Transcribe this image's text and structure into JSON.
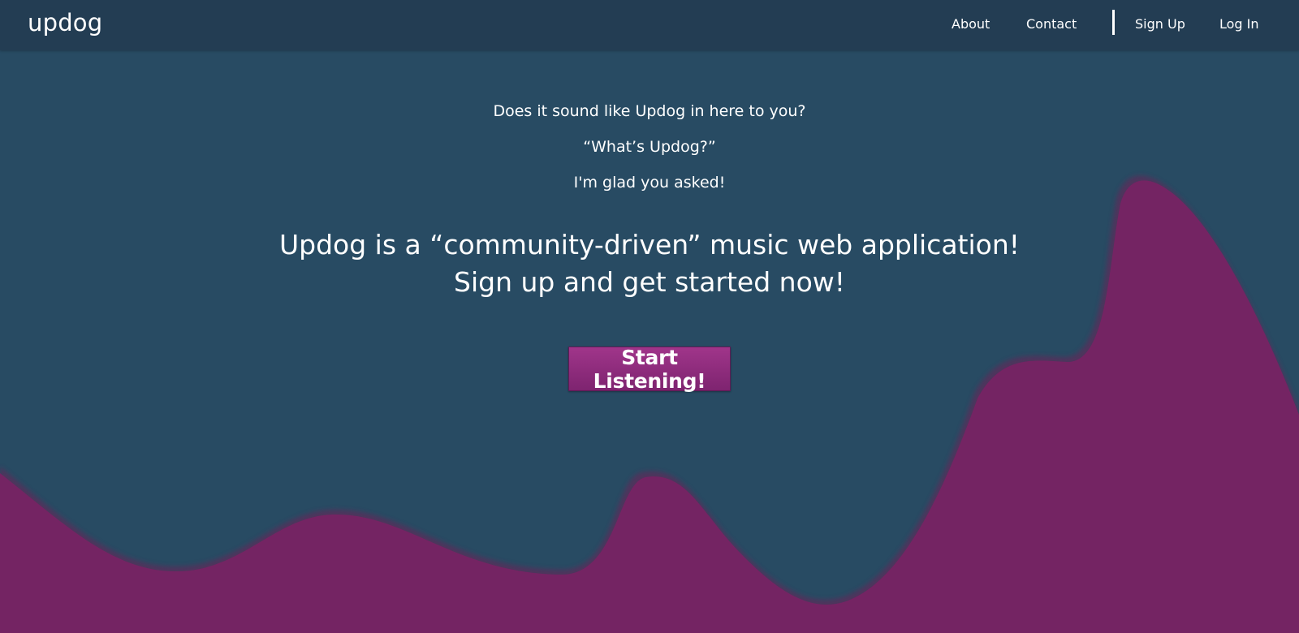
{
  "nav": {
    "brand": "updog",
    "links": {
      "about": "About",
      "contact": "Contact",
      "sign_up": "Sign Up",
      "log_in": "Log In"
    }
  },
  "hero": {
    "intro_lines": [
      "Does it sound like Updog in here to you?",
      "“What’s Updog?”",
      "I'm glad you asked!"
    ],
    "headline_lines": [
      "Updog is a “community-driven” music web application!",
      "Sign up and get started now!"
    ],
    "cta_label": "Start Listening!"
  },
  "colors": {
    "background": "#284b63",
    "navbar": "#233d53",
    "wave": "#742463",
    "cta": "#8e2c7f",
    "text": "#ffffff"
  }
}
